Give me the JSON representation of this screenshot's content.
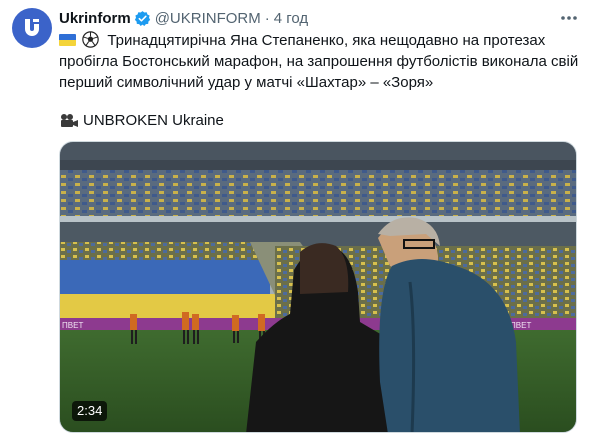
{
  "account": {
    "name": "Ukrinform",
    "handle": "@UKRINFORM",
    "separator": "·",
    "time": "4 год"
  },
  "tweet": {
    "text": "Тринадцятирічна Яна Степаненко, яка нещодавно на протезах пробігла Бостонський марафон, на запрошення футболістів виконала свій перший символічний удар у матчі «Шахтар» – «Зоря»",
    "credit": "UNBROKEN Ukraine"
  },
  "media": {
    "duration": "2:34",
    "stadium_banner": "ΠBET"
  },
  "colors": {
    "accent": "#1d9bf0",
    "avatar": "#3b63c9",
    "text": "#0f1419",
    "muted": "#536471"
  },
  "icons": [
    "logo-icon",
    "verified-badge-icon",
    "more-icon",
    "ukraine-flag-icon",
    "soccer-ball-icon",
    "video-camera-icon"
  ]
}
